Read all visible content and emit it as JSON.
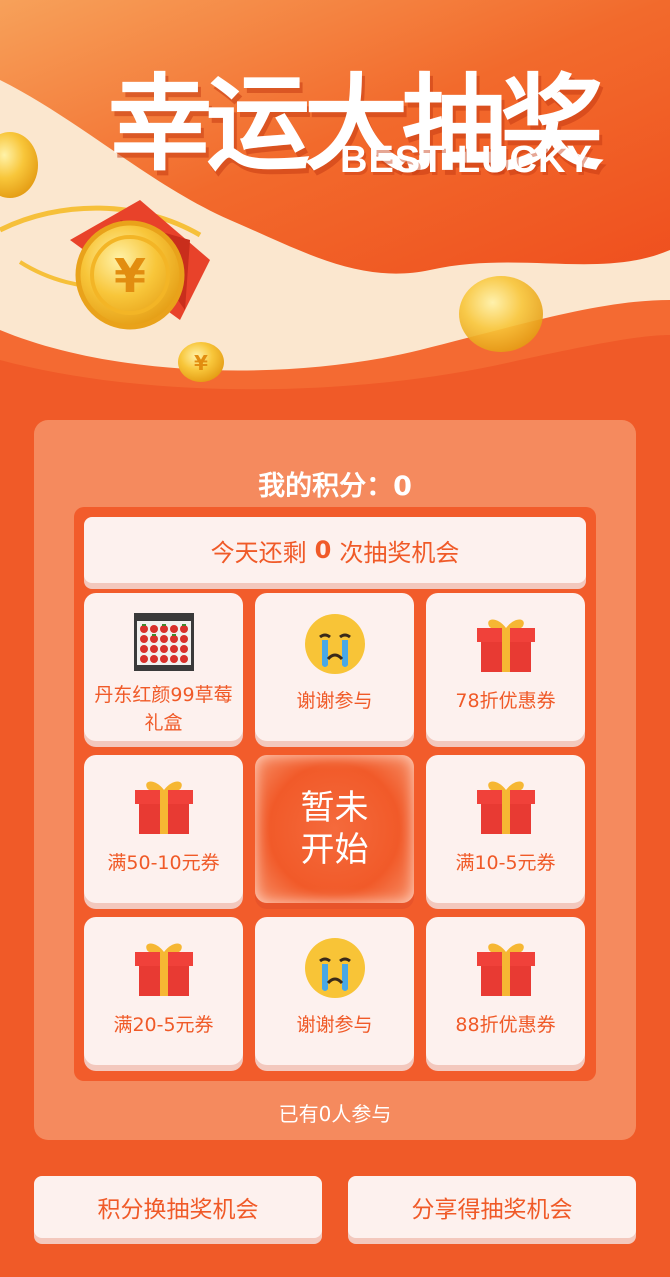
{
  "hero": {
    "title": "幸运大抽奖",
    "subtitle": "BEST LUCKY"
  },
  "points": {
    "label": "我的积分：",
    "value": "0"
  },
  "chances": {
    "prefix": "今天还剩",
    "count": "0",
    "suffix": "次抽奖机会"
  },
  "grid": {
    "cells": [
      {
        "label": "丹东红颜99草莓礼盒",
        "icon": "strawberry-photo"
      },
      {
        "label": "谢谢参与",
        "icon": "crying-face-icon"
      },
      {
        "label": "78折优惠券",
        "icon": "gift-box-icon"
      },
      {
        "label": "满50-10元券",
        "icon": "gift-box-icon"
      },
      {
        "label": "满10-5元券",
        "icon": "gift-box-icon"
      },
      {
        "label": "满20-5元券",
        "icon": "gift-box-icon"
      },
      {
        "label": "谢谢参与",
        "icon": "crying-face-icon"
      },
      {
        "label": "88折优惠券",
        "icon": "gift-box-icon"
      }
    ],
    "start_label_line1": "暂未",
    "start_label_line2": "开始"
  },
  "participants": "已有0人参与",
  "buttons": {
    "exchange": "积分换抽奖机会",
    "share": "分享得抽奖机会"
  },
  "colors": {
    "primary": "#f05a28",
    "panel": "#f58a5e",
    "card": "#fdf1ee"
  }
}
